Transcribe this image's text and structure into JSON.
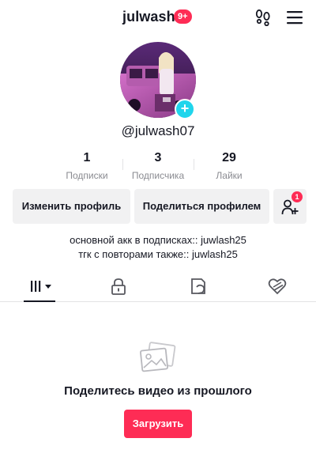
{
  "header": {
    "username": "julwash",
    "notification_badge": "9+",
    "icons": [
      "footprints-icon",
      "hamburger-menu-icon"
    ]
  },
  "profile": {
    "handle": "@julwash07",
    "avatar_add_icon": "plus-icon",
    "avatar_add_label": "+"
  },
  "stats": [
    {
      "value": "1",
      "label": "Подписки"
    },
    {
      "value": "3",
      "label": "Подписчика"
    },
    {
      "value": "29",
      "label": "Лайки"
    }
  ],
  "actions": {
    "edit_label": "Изменить профиль",
    "share_label": "Поделиться профилем",
    "add_friend_icon": "add-friend-icon",
    "add_friend_badge": "1"
  },
  "bio": {
    "line1": "основной акк в подписках:: juwlash25",
    "line2": "тгк с повторами также:: juwlash25"
  },
  "tabs": [
    {
      "icon": "grid-icon",
      "selected": true
    },
    {
      "icon": "lock-icon",
      "selected": false
    },
    {
      "icon": "repost-icon",
      "selected": false
    },
    {
      "icon": "liked-heart-icon",
      "selected": false
    }
  ],
  "empty_state": {
    "icon": "image-placeholder-icon",
    "title": "Поделитесь видео из прошлого",
    "button_label": "Загрузить"
  },
  "colors": {
    "accent": "#fe2c55",
    "avatar_badge": "#20d5ec",
    "text": "#161823",
    "secondary_text": "#8a8b91",
    "button_bg": "#f1f1f2"
  }
}
